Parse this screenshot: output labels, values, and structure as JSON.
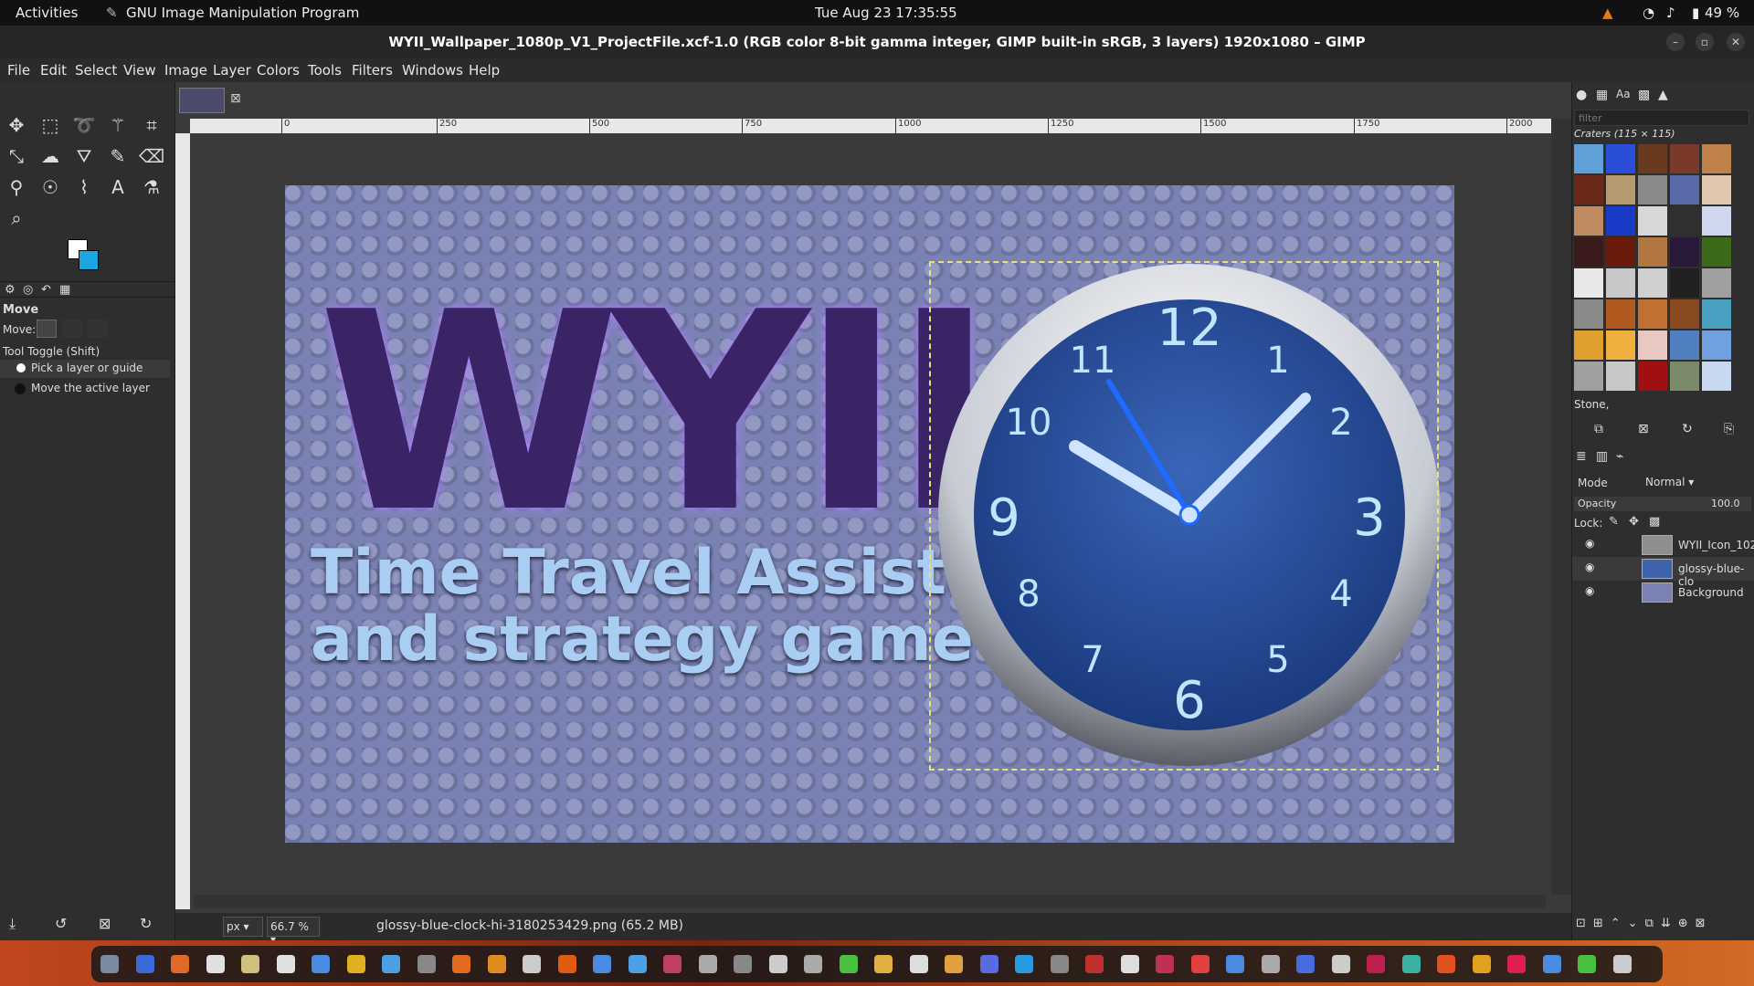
{
  "topbar": {
    "activities": "Activities",
    "app_name": "GNU Image Manipulation Program",
    "datetime": "Tue Aug 23  17:35:55",
    "battery": "49 %"
  },
  "window": {
    "title": "WYII_Wallpaper_1080p_V1_ProjectFile.xcf-1.0 (RGB color 8-bit gamma integer, GIMP built-in sRGB, 3 layers) 1920x1080 – GIMP"
  },
  "menu": [
    "File",
    "Edit",
    "Select",
    "View",
    "Image",
    "Layer",
    "Colors",
    "Tools",
    "Filters",
    "Windows",
    "Help"
  ],
  "tool_options": {
    "title": "Move",
    "move_label": "Move:",
    "toggle_label": "Tool Toggle  (Shift)",
    "option1": "Pick a layer or guide",
    "option2": "Move the active layer"
  },
  "ruler_labels": [
    "0",
    "250",
    "500",
    "750",
    "1000",
    "1250",
    "1500",
    "1750",
    "2000"
  ],
  "canvas": {
    "logo_text": "WYII",
    "line1": "Time Travel Assistant",
    "line2": "and strategy game"
  },
  "clock_numbers": [
    "12",
    "1",
    "2",
    "3",
    "4",
    "5",
    "6",
    "7",
    "8",
    "9",
    "10",
    "11"
  ],
  "patterns": {
    "filter_placeholder": "filter",
    "selected": "Craters (115 × 115)",
    "tag": "Stone,"
  },
  "layers_panel": {
    "mode_label": "Mode",
    "mode_value": "Normal",
    "opacity_label": "Opacity",
    "opacity_value": "100.0",
    "lock_label": "Lock:",
    "layers": [
      "WYII_Icon_102",
      "glossy-blue-clo",
      "Background"
    ]
  },
  "status": {
    "unit": "px",
    "zoom": "66.7 %",
    "message": "glossy-blue-clock-hi-3180253429.png (65.2 MB)"
  },
  "colors": {
    "foreground": "#ffffff",
    "background": "#1ba6e0",
    "canvas_bg": "#7a82b4"
  }
}
